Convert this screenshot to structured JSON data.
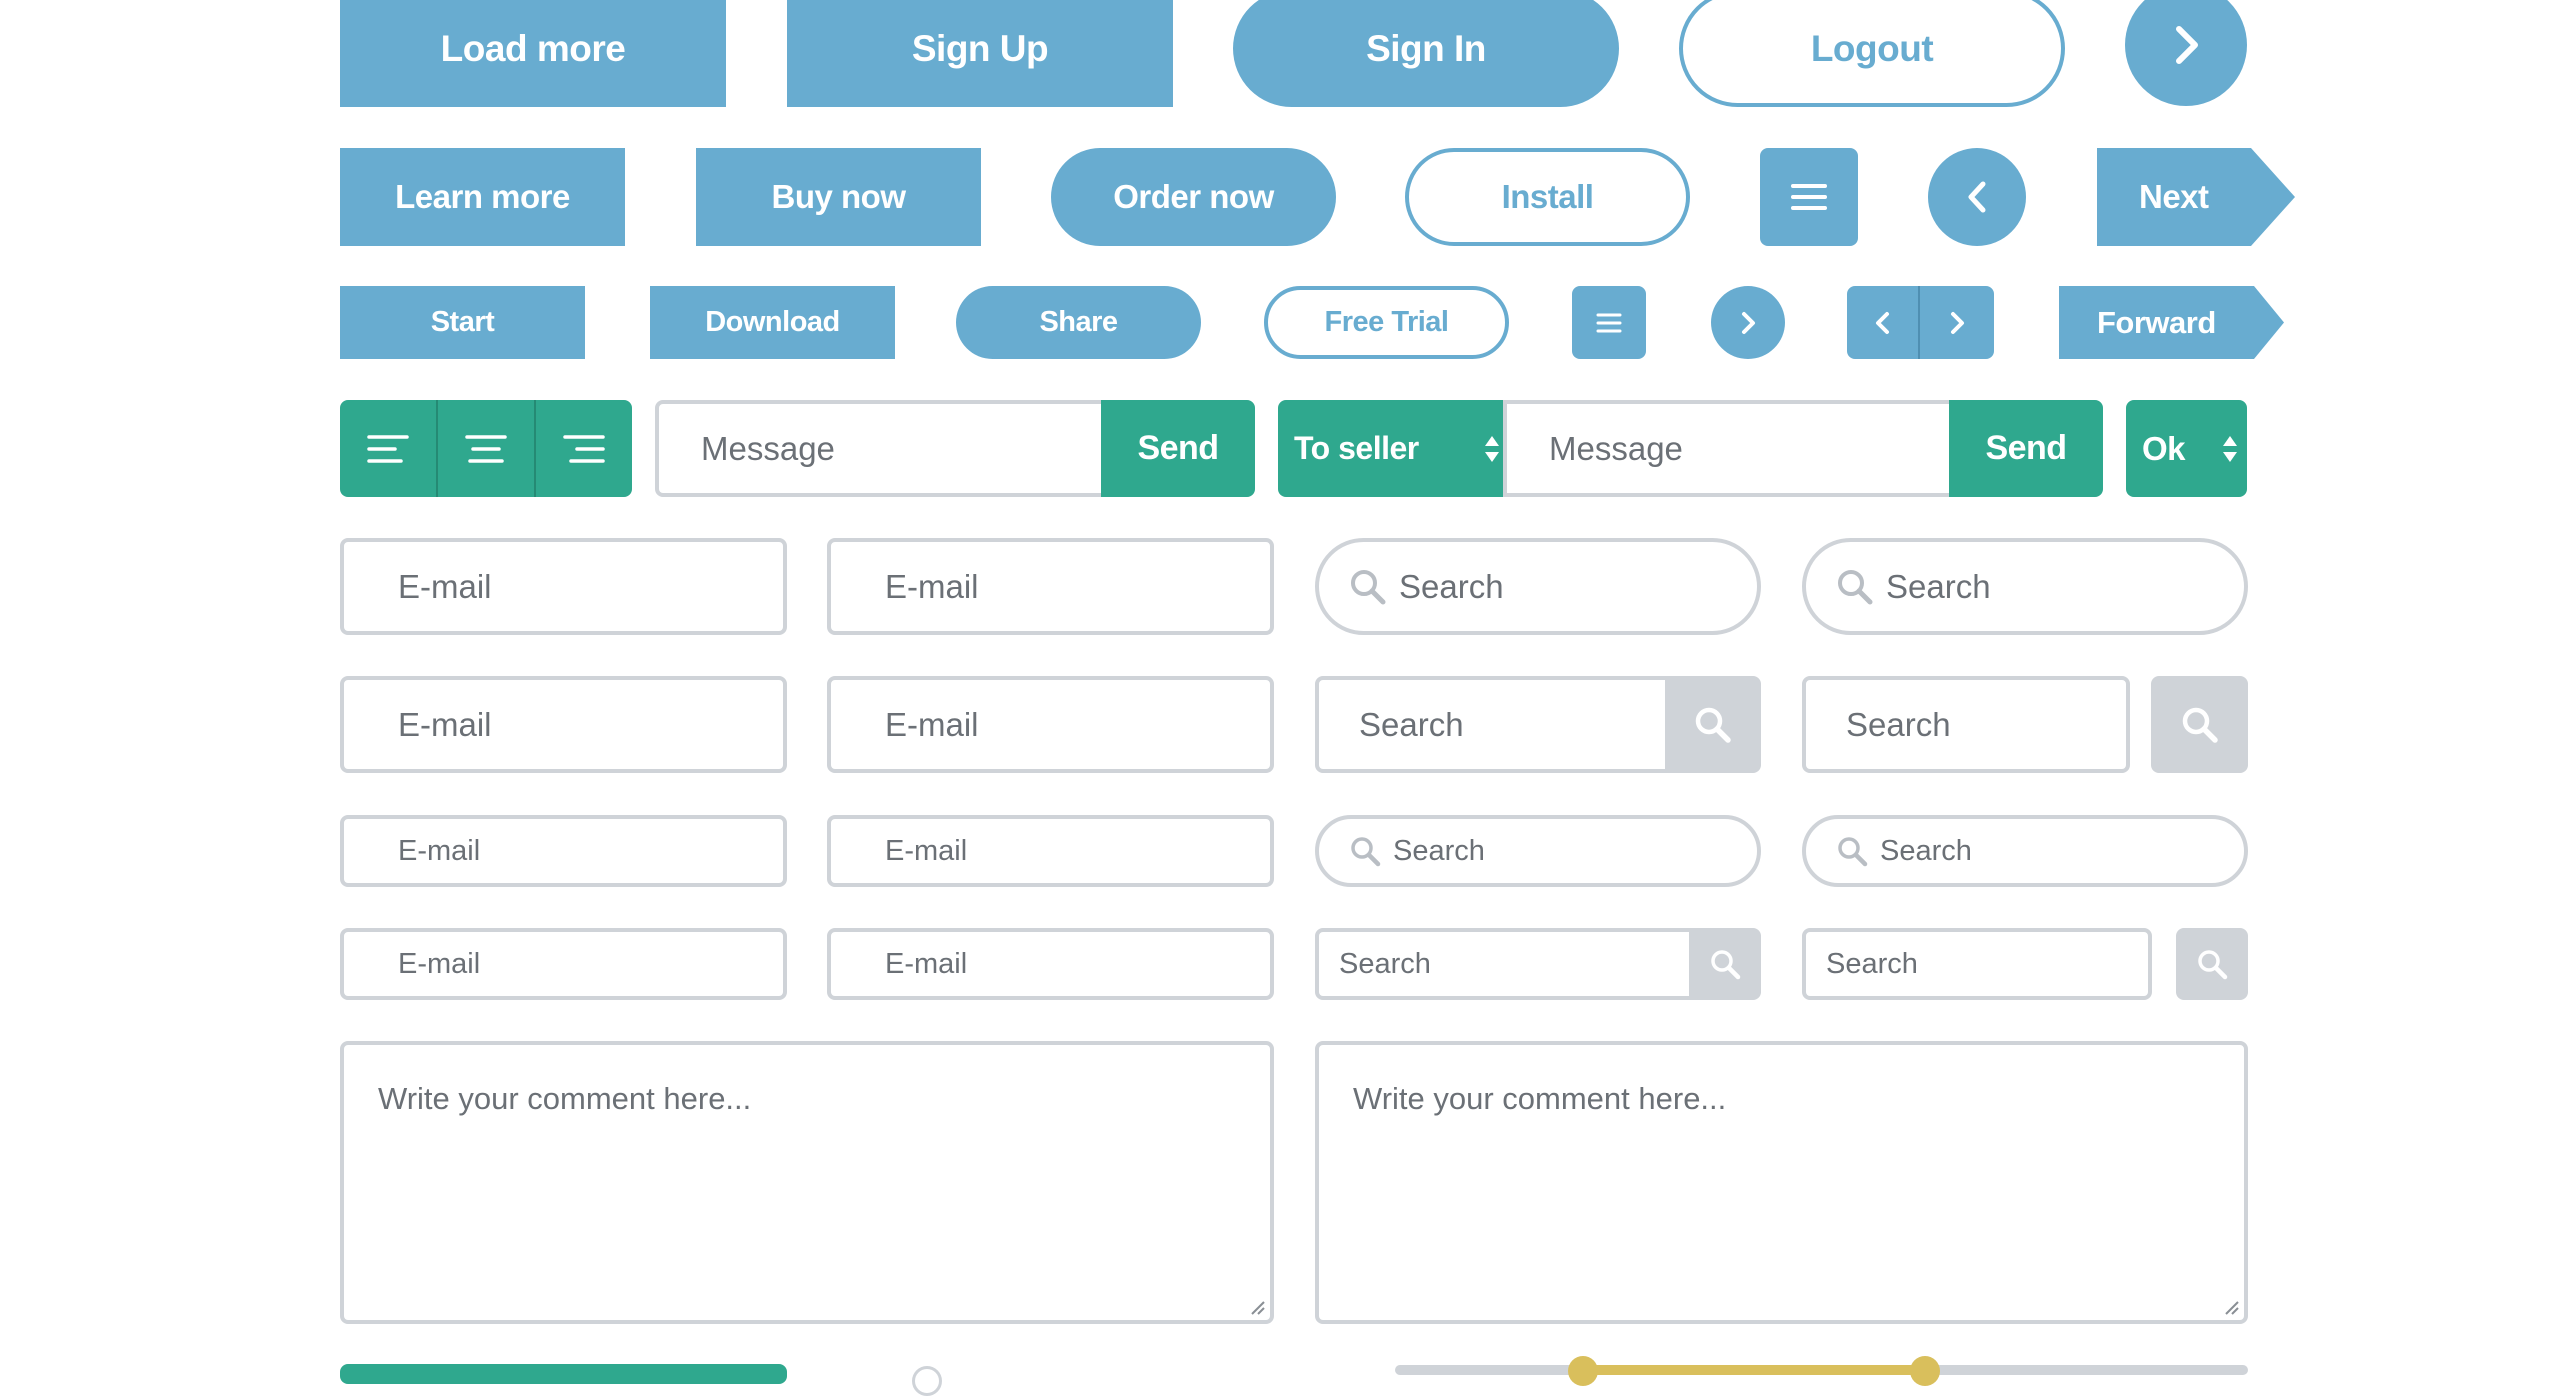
{
  "row1": {
    "load_more": "Load more",
    "sign_up": "Sign Up",
    "sign_in": "Sign In",
    "logout": "Logout"
  },
  "row2": {
    "learn_more": "Learn more",
    "buy_now": "Buy now",
    "order_now": "Order now",
    "install": "Install",
    "next": "Next"
  },
  "row3": {
    "start": "Start",
    "download": "Download",
    "share": "Share",
    "free_trial": "Free Trial",
    "forward": "Forward"
  },
  "row4": {
    "message_placeholder_1": "Message",
    "send_1": "Send",
    "to_seller": "To seller",
    "message_placeholder_2": "Message",
    "send_2": "Send",
    "ok": "Ok"
  },
  "fields": {
    "email": "E-mail",
    "search": "Search"
  },
  "comments": {
    "placeholder_left": "Write your comment here...",
    "placeholder_right": "Write your comment here..."
  },
  "colors": {
    "blue": "#68acd0",
    "teal": "#2fa88e",
    "border_gray": "#cfd3d8",
    "slider_gold": "#d9bf5c"
  },
  "icons": [
    "chevron-right-icon",
    "chevron-left-icon",
    "hamburger-icon",
    "align-left-icon",
    "align-center-icon",
    "align-right-icon",
    "select-arrows-icon",
    "search-icon"
  ]
}
